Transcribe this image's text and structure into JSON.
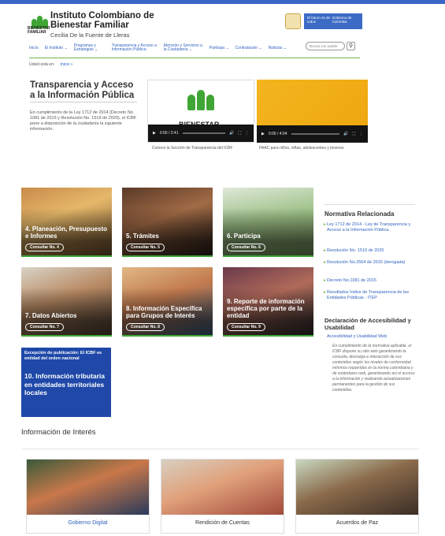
{
  "header": {
    "logo_word": "BIENESTAR FAMILIAR",
    "institution": "Instituto Colombiano de Bienestar Familiar",
    "subtitle": "Cecilia De la Fuente de Lleras",
    "gov_left": "El futuro es de todos",
    "gov_right": "Gobierno de Colombia"
  },
  "nav": {
    "items": [
      "Inicio",
      "El Instituto ⌄",
      "Programas y Estrategias ⌄",
      "Transparencia y Acceso a Información Pública",
      "Atención y Servicios a la Ciudadanía ⌄",
      "Participa ⌄",
      "Contratación ⌄",
      "Noticias ⌄"
    ],
    "search_placeholder": "Buscar por palabr",
    "search_icon": "magnifier-icon"
  },
  "breadcrumb": {
    "prefix": "Usted está en:",
    "home": "Inicio »"
  },
  "main": {
    "title": "Transparencia y Acceso a la Información Pública",
    "intro": "En cumplimiento de la Ley 1712 de 2014 (Decreto No. 1081 de 2015 y Resolución No. 1519 de 2020), el ICBF pone a disposición de la ciudadanía la siguiente información.",
    "videos": [
      {
        "logo_word": "BIENESTAR FAMILIAR",
        "time": "0:00 / 2:41",
        "caption": "Conoce la Sección de Transparencia del ICBF"
      },
      {
        "time": "0:00 / 4:04",
        "caption": "PAAC para niños, niñas, adolescentes y jóvenes"
      }
    ]
  },
  "tiles": [
    {
      "title": "4. Planeación, Presupuesto e Informes",
      "button": "Consultar No. 4"
    },
    {
      "title": "5. Trámites",
      "button": "Consultar No. 5"
    },
    {
      "title": "6. Participa",
      "button": "Consultar No. 6"
    },
    {
      "title": "7. Datos Abiertos",
      "button": "Consultar No. 7"
    },
    {
      "title": "8. Información Específica para Grupos de Interés",
      "button": "Consultar No. 8"
    },
    {
      "title": "9. Reporte de información específica por parte de la entidad",
      "button": "Consultar No. 9"
    }
  ],
  "tile_10": {
    "exception": "Excepción de publicación: El ICBF es entidad del orden nacional",
    "title": "10. Información tributaria en entidades territoriales locales"
  },
  "aside": {
    "title": "Normativa Relacionada",
    "links": [
      "Ley 1712 de 2014 - Ley de Transparencia y Acceso a la Información Pública.",
      "Resolución No. 1519 de 2020",
      "Resolución No.3564 de 2015 (derogada)",
      "Decreto No.1081 de 2015",
      "Resultados Índice de Transparencia de las Entidades Públicas - ITEP"
    ],
    "declaration_title": "Declaración de Accesibilidad y Usabilidad",
    "declaration_link": "Accesibilidad y Usabilidad Web",
    "declaration_text": "En cumplimiento de la normativa aplicable, el ICBF dispone su sitio web garantizando la consulta, descarga e interacción de sus contenidos según los niveles de conformidad mínimos requeridos en la norma colombiana y de estándares web, garantizando así el acceso a la información y realizando actualizaciones permanentes para la gestión de sus contenidos."
  },
  "interest": {
    "title": "Información de Interés",
    "cards": [
      "Gobierno Digital",
      "Rendición de Cuentas",
      "Acuerdos de Paz"
    ]
  },
  "colors": {
    "brand_blue": "#2f63bf",
    "brand_green": "#3fa535",
    "tile_blue": "#1f48a8"
  }
}
